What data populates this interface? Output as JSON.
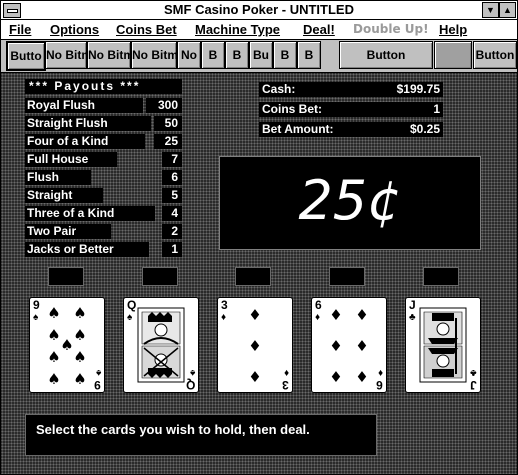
{
  "window": {
    "title": "SMF Casino Poker - UNTITLED"
  },
  "menu": [
    {
      "label": "File",
      "enabled": true
    },
    {
      "label": "Options",
      "enabled": true
    },
    {
      "label": "Coins Bet",
      "enabled": true
    },
    {
      "label": "Machine Type",
      "enabled": true
    },
    {
      "label": "Deal!",
      "enabled": true
    },
    {
      "label": "Double Up!",
      "enabled": false
    },
    {
      "label": "Help",
      "enabled": true
    }
  ],
  "toolbar": [
    "Butto",
    "No Bitm",
    "No Bitm",
    "No Bitm",
    "No",
    "B",
    "B",
    "Bu",
    "B",
    "B",
    "Button",
    "",
    "Button"
  ],
  "payouts": {
    "heading": "*** Payouts ***",
    "rows": [
      {
        "hand": "Royal Flush",
        "pays": "300"
      },
      {
        "hand": "Straight Flush",
        "pays": "50"
      },
      {
        "hand": "Four of a Kind",
        "pays": "25"
      },
      {
        "hand": "Full House",
        "pays": "7"
      },
      {
        "hand": "Flush",
        "pays": "6"
      },
      {
        "hand": "Straight",
        "pays": "5"
      },
      {
        "hand": "Three of a Kind",
        "pays": "4"
      },
      {
        "hand": "Two Pair",
        "pays": "2"
      },
      {
        "hand": "Jacks or Better",
        "pays": "1"
      }
    ]
  },
  "info": {
    "cash_label": "Cash:",
    "cash": "$199.75",
    "coins_label": "Coins Bet:",
    "coins": "1",
    "bet_label": "Bet Amount:",
    "bet": "$0.25"
  },
  "denomination": "25¢",
  "cards": [
    {
      "rank": "9",
      "suit": "♠",
      "color": "#000000"
    },
    {
      "rank": "Q",
      "suit": "♠",
      "color": "#000000"
    },
    {
      "rank": "3",
      "suit": "♦",
      "color": "#000000"
    },
    {
      "rank": "6",
      "suit": "♦",
      "color": "#000000"
    },
    {
      "rank": "J",
      "suit": "♣",
      "color": "#000000"
    }
  ],
  "status": "Select the cards you wish to hold, then deal."
}
